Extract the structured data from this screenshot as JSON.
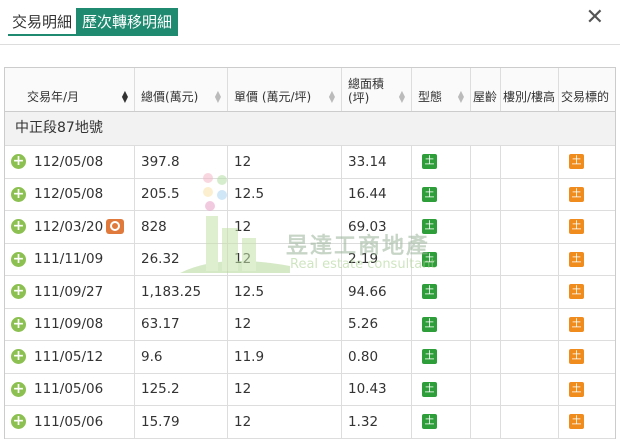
{
  "tabs": [
    {
      "label": "交易明細"
    },
    {
      "label": "歷次轉移明細"
    }
  ],
  "close_glyph": "✕",
  "table": {
    "columns": [
      "交易年/月",
      "總價(萬元)",
      "單價 (萬元/坪)",
      "總面積\n(坪)",
      "型態",
      "屋齡",
      "樓別/樓高",
      "交易標的"
    ],
    "group_label": "中正段87地號",
    "type_badge": "土",
    "target_badge": "土",
    "rows": [
      {
        "date": "112/05/08",
        "total": "397.8",
        "unit": "12",
        "area": "33.14"
      },
      {
        "date": "112/05/08",
        "total": "205.5",
        "unit": "12.5",
        "area": "16.44"
      },
      {
        "date": "112/03/20",
        "total": "828",
        "unit": "12",
        "area": "69.03",
        "has_search_icon": true
      },
      {
        "date": "111/11/09",
        "total": "26.32",
        "unit": "12",
        "area": "2.19"
      },
      {
        "date": "111/09/27",
        "total": "1,183.25",
        "unit": "12.5",
        "area": "94.66"
      },
      {
        "date": "111/09/08",
        "total": "63.17",
        "unit": "12",
        "area": "5.26"
      },
      {
        "date": "111/05/12",
        "total": "9.6",
        "unit": "11.9",
        "area": "0.80"
      },
      {
        "date": "111/05/06",
        "total": "125.2",
        "unit": "12",
        "area": "10.43"
      },
      {
        "date": "111/05/06",
        "total": "15.79",
        "unit": "12",
        "area": "1.32"
      }
    ]
  },
  "watermark": {
    "title": "昱達工商地產",
    "subtitle": "Real estate consultant"
  },
  "colors": {
    "accent": "#1f8a70",
    "type_green": "#2e9e3a",
    "target_orange": "#f08c1e",
    "expand_green": "#8cc152"
  }
}
